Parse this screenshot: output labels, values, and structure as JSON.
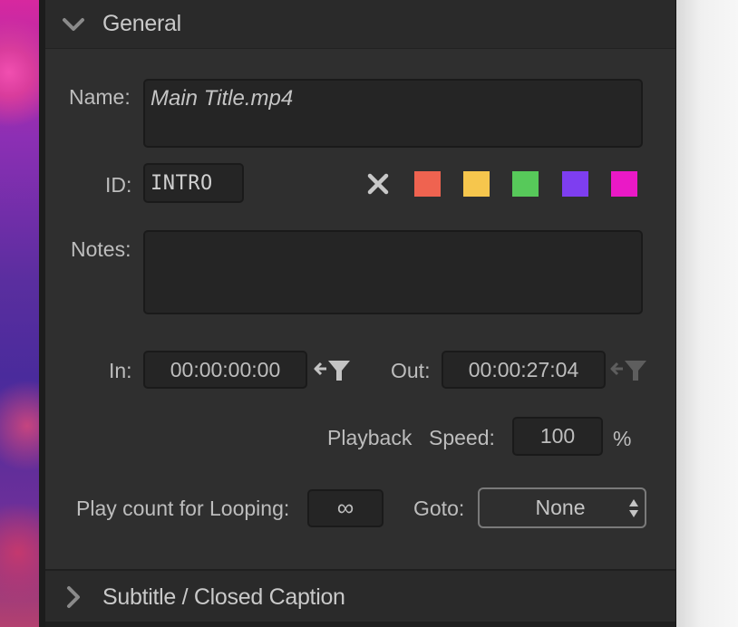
{
  "general": {
    "title": "General",
    "name_label": "Name:",
    "name_value": "Main Title.mp4",
    "id_label": "ID:",
    "id_value": "INTRO",
    "notes_label": "Notes:",
    "notes_value": "",
    "color_tags": [
      "#ef6350",
      "#f6c64d",
      "#57c95a",
      "#7e3ef0",
      "#ea19c6"
    ],
    "in_label": "In:",
    "in_value": "00:00:00:00",
    "out_label": "Out:",
    "out_value": "00:00:27:04",
    "playback_label": "Playback",
    "speed_label": "Speed:",
    "speed_value": "100",
    "speed_unit": "%",
    "loop_label": "Play count for Looping:",
    "loop_value": "∞",
    "goto_label": "Goto:",
    "goto_value": "None"
  },
  "subtitle_section": {
    "title": "Subtitle / Closed Caption"
  },
  "icons": {
    "general_chevron": "chevron-down-icon",
    "subtitle_chevron": "chevron-right-icon",
    "clear_color": "close-icon",
    "set_in": "set-in-point-icon",
    "set_out": "set-out-point-icon",
    "goto_arrows": "select-arrows-icon"
  }
}
